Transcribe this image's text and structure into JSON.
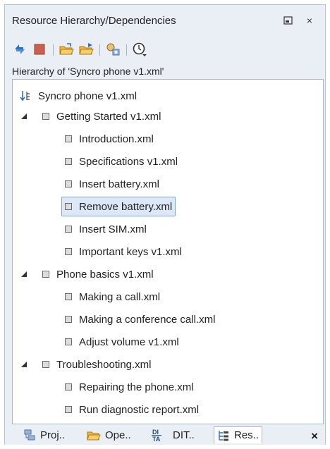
{
  "view": {
    "title": "Resource Hierarchy/Dependencies",
    "hierarchy_label": "Hierarchy of 'Syncro phone v1.xml'"
  },
  "toolbar": {
    "items": [
      "refresh-icon",
      "stop-icon",
      "open-folder-icon",
      "open-folder-arrow-icon",
      "search-config-icon",
      "history-dropdown-icon"
    ]
  },
  "tree": {
    "root": "Syncro phone v1.xml",
    "nodes": [
      {
        "label": "Getting Started v1.xml",
        "level": 1,
        "expanded": true
      },
      {
        "label": "Introduction.xml",
        "level": 2
      },
      {
        "label": "Specifications v1.xml",
        "level": 2
      },
      {
        "label": "Insert battery.xml",
        "level": 2
      },
      {
        "label": "Remove battery.xml",
        "level": 2,
        "selected": true
      },
      {
        "label": "Insert SIM.xml",
        "level": 2
      },
      {
        "label": "Important keys v1.xml",
        "level": 2
      },
      {
        "label": "Phone basics v1.xml",
        "level": 1,
        "expanded": true
      },
      {
        "label": "Making a call.xml",
        "level": 2
      },
      {
        "label": "Making a conference call.xml",
        "level": 2
      },
      {
        "label": "Adjust volume v1.xml",
        "level": 2
      },
      {
        "label": "Troubleshooting.xml",
        "level": 1,
        "expanded": true
      },
      {
        "label": "Repairing the phone.xml",
        "level": 2
      },
      {
        "label": "Run diagnostic report.xml",
        "level": 2
      }
    ]
  },
  "tabs": [
    {
      "label": "Proj..",
      "icon": "project-icon"
    },
    {
      "label": "Ope..",
      "icon": "open-folder-icon"
    },
    {
      "label": "DIT..",
      "icon": "dita-icon"
    },
    {
      "label": "Res..",
      "icon": "resource-hierarchy-icon",
      "active": true
    }
  ],
  "tabbar": {
    "close_glyph": "×"
  },
  "window": {
    "minimize_glyph": "◱",
    "close_glyph": "×"
  }
}
